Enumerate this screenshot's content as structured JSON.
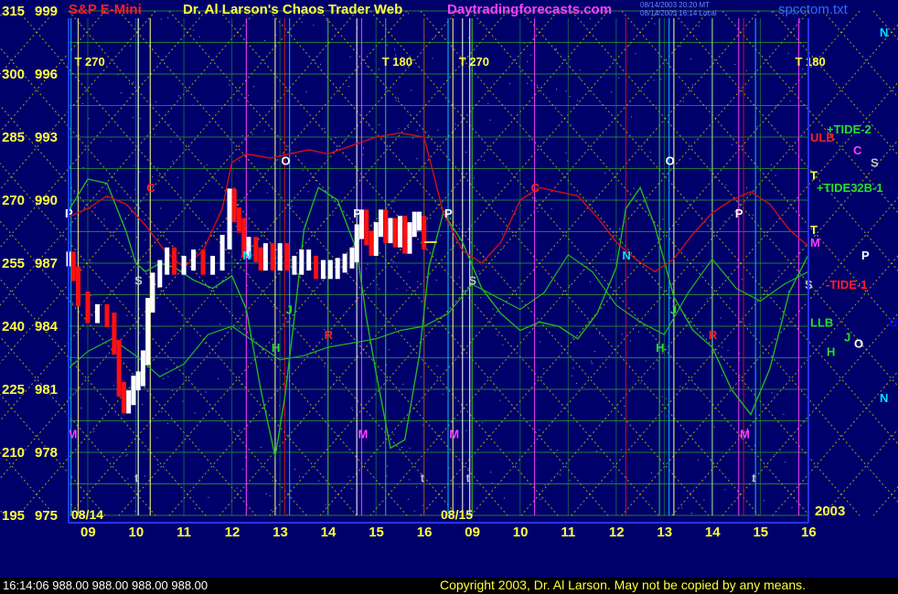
{
  "header": {
    "symbol": "S&P E-Mini",
    "title": "Dr. Al Larson's Chaos Trader Web",
    "site": "Daytradingforecasts.com",
    "stamp1": "08/14/2003 20:20 MT",
    "stamp2": "08/14/2003 16:14 Local",
    "file": "spcctom.txt"
  },
  "status": {
    "time": "16:14:06",
    "quotes": "988.00 988.00 988.00 988.00"
  },
  "copyright": "Copyright 2003, Dr. Al Larson. May not be copied by any means.",
  "colors": {
    "background": "#00006b",
    "grid": "#2ea12e",
    "diagonal": "#c8c800",
    "price_bar": "#ffffff",
    "down_bar": "#ff1010",
    "red_line": "#d01010",
    "green_line": "#23b623"
  },
  "chart_data": {
    "type": "line",
    "title": "S&P E-Mini",
    "days": [
      "08/14",
      "08/15"
    ],
    "year": "2003",
    "x_ticks": [
      "09",
      "10",
      "11",
      "12",
      "13",
      "14",
      "15",
      "16",
      "09",
      "10",
      "11",
      "12",
      "13",
      "14",
      "15",
      "16"
    ],
    "ylim": [
      975,
      999
    ],
    "y_axis": [
      {
        "price": 999,
        "label": "315"
      },
      {
        "price": 996,
        "label": "300"
      },
      {
        "price": 993,
        "label": "285"
      },
      {
        "price": 990,
        "label": "270"
      },
      {
        "price": 987,
        "label": "255"
      },
      {
        "price": 984,
        "label": "240"
      },
      {
        "price": 981,
        "label": "225"
      },
      {
        "price": 978,
        "label": "210"
      },
      {
        "price": 975,
        "label": "195"
      }
    ],
    "price_series": {
      "name": "S&P E-Mini",
      "t": [
        8.6,
        8.7,
        8.8,
        9.0,
        9.2,
        9.4,
        9.55,
        9.65,
        9.75,
        9.85,
        9.95,
        10.05,
        10.15,
        10.25,
        10.35,
        10.5,
        10.65,
        10.8,
        11.0,
        11.2,
        11.4,
        11.6,
        11.8,
        11.95,
        12.05,
        12.15,
        12.25,
        12.35,
        12.5,
        12.6,
        12.7,
        12.85,
        13.0,
        13.15,
        13.3,
        13.45,
        13.6,
        13.75,
        13.9,
        14.05,
        14.2,
        14.35,
        14.5,
        14.6,
        14.7,
        14.8,
        14.9,
        15.0,
        15.1,
        15.2,
        15.3,
        15.4,
        15.5,
        15.6,
        15.7,
        15.8,
        15.9,
        16.0
      ],
      "close": [
        987.2,
        986.5,
        985.3,
        984.5,
        984.7,
        984.3,
        983.0,
        981.0,
        980.2,
        980.6,
        981.3,
        981.5,
        982.5,
        985.0,
        986.2,
        986.8,
        987.4,
        986.8,
        987.0,
        987.3,
        986.8,
        987.0,
        988.0,
        990.2,
        989.3,
        988.8,
        987.6,
        987.9,
        987.4,
        987.0,
        987.6,
        987.0,
        987.6,
        987.0,
        986.8,
        987.3,
        987.0,
        986.6,
        986.8,
        986.6,
        986.9,
        987.1,
        987.4,
        988.5,
        989.2,
        988.2,
        987.7,
        988.6,
        989.2,
        988.3,
        988.8,
        988.1,
        988.9,
        987.8,
        988.6,
        989.1,
        988.9,
        988.0
      ]
    },
    "red_series": {
      "name": "R",
      "t": [
        8.6,
        9.0,
        9.4,
        9.8,
        10.2,
        10.6,
        11.0,
        11.4,
        11.8,
        12.0,
        12.3,
        12.8,
        13.2,
        13.6,
        14.0,
        14.5,
        15.0,
        15.5,
        16.0,
        16.4,
        16.8,
        17.2,
        17.6,
        18.0,
        18.4,
        18.8,
        19.2,
        19.6,
        20.0,
        20.4,
        20.8,
        21.2,
        21.6,
        22.0,
        22.4,
        22.8,
        23.2,
        23.6,
        24.0
      ],
      "values": [
        989.2,
        989.6,
        990.2,
        989.8,
        988.8,
        987.6,
        986.8,
        987.6,
        989.6,
        991.8,
        992.2,
        992.0,
        992.2,
        992.4,
        992.2,
        992.6,
        993.0,
        993.2,
        993.0,
        989.4,
        987.6,
        987.0,
        988.0,
        990.0,
        990.6,
        990.4,
        990.2,
        989.2,
        988.0,
        987.2,
        986.6,
        987.2,
        988.4,
        989.4,
        990.0,
        990.4,
        989.8,
        988.6,
        987.8
      ]
    },
    "green_series": {
      "name": "J",
      "t": [
        8.6,
        9.0,
        9.4,
        9.8,
        10.0,
        10.2,
        10.5,
        10.8,
        11.2,
        11.6,
        12.0,
        12.3,
        12.6,
        12.9,
        13.1,
        13.3,
        13.5,
        13.8,
        14.2,
        14.6,
        14.8,
        15.0,
        15.3,
        15.6,
        15.9,
        16.1,
        16.4,
        16.8,
        17.2,
        17.6,
        18.0,
        18.4,
        18.8,
        19.2,
        19.6,
        20.0,
        20.2,
        20.5,
        20.8,
        21.2,
        21.6,
        22.0,
        22.4,
        22.8,
        23.2,
        23.6,
        24.0
      ],
      "values": [
        989.5,
        991.0,
        990.8,
        988.5,
        987.0,
        986.6,
        987.0,
        986.8,
        986.2,
        985.8,
        986.4,
        984.8,
        981.0,
        977.8,
        980.6,
        984.4,
        988.6,
        990.6,
        990.0,
        987.6,
        984.4,
        981.8,
        978.2,
        978.6,
        982.6,
        986.8,
        989.4,
        988.0,
        985.8,
        984.6,
        983.8,
        984.2,
        984.0,
        983.4,
        984.6,
        986.8,
        989.6,
        990.6,
        988.8,
        985.4,
        983.8,
        983.0,
        981.0,
        979.8,
        982.0,
        985.6,
        987.4
      ]
    },
    "green_series_2": {
      "name": "H",
      "t": [
        8.6,
        9.0,
        9.5,
        10.0,
        10.5,
        11.0,
        11.5,
        12.0,
        12.5,
        13.0,
        13.5,
        14.0,
        14.5,
        15.0,
        15.5,
        16.0,
        16.5,
        17.0,
        17.5,
        18.0,
        18.5,
        19.0,
        19.5,
        20.0,
        20.5,
        21.0,
        21.5,
        22.0,
        22.5,
        23.0,
        23.5,
        24.0
      ],
      "values": [
        982.0,
        982.8,
        983.4,
        982.6,
        981.6,
        982.2,
        983.6,
        984.0,
        983.2,
        982.4,
        982.6,
        983.0,
        983.2,
        983.4,
        983.8,
        984.0,
        984.6,
        986.0,
        985.4,
        984.8,
        985.6,
        987.4,
        986.6,
        985.0,
        984.2,
        983.6,
        985.6,
        987.2,
        985.8,
        985.2,
        986.0,
        986.6
      ]
    },
    "vertical_markers": [
      {
        "label": "T 270",
        "t": 8.8,
        "level": 996.6
      },
      {
        "label": "T 180",
        "t": 15.2,
        "level": 996.6
      },
      {
        "label": "T 270",
        "t": 16.8,
        "level": 996.6
      },
      {
        "label": "T 180",
        "t": 23.8,
        "level": 996.6
      },
      {
        "label": "P",
        "t": 8.6,
        "level": 989.4
      },
      {
        "label": "M",
        "t": 8.65,
        "level": 978.9
      },
      {
        "label": "C",
        "t": 10.3,
        "level": 990.6
      },
      {
        "label": "S",
        "t": 10.05,
        "level": 986.2
      },
      {
        "label": "t",
        "t": 10.05,
        "level": 976.8
      },
      {
        "label": "N",
        "t": 12.3,
        "level": 987.4
      },
      {
        "label": "O",
        "t": 13.1,
        "level": 991.9
      },
      {
        "label": "J",
        "t": 13.2,
        "level": 984.8
      },
      {
        "label": "H",
        "t": 12.9,
        "level": 983.0
      },
      {
        "label": "R",
        "t": 14.0,
        "level": 983.6
      },
      {
        "label": "P",
        "t": 14.6,
        "level": 989.4
      },
      {
        "label": "M",
        "t": 14.7,
        "level": 978.9
      },
      {
        "label": "t",
        "t": 16.0,
        "level": 976.8
      },
      {
        "label": "P",
        "t": 16.5,
        "level": 989.4
      },
      {
        "label": "M",
        "t": 16.6,
        "level": 978.9
      },
      {
        "label": "S",
        "t": 17.0,
        "level": 986.2
      },
      {
        "label": "t",
        "t": 16.95,
        "level": 976.8
      },
      {
        "label": "C",
        "t": 18.3,
        "level": 990.6
      },
      {
        "label": "N",
        "t": 20.2,
        "level": 987.4
      },
      {
        "label": "O",
        "t": 21.1,
        "level": 991.9
      },
      {
        "label": "J",
        "t": 21.2,
        "level": 984.8
      },
      {
        "label": "H",
        "t": 20.9,
        "level": 983.0
      },
      {
        "label": "R",
        "t": 22.0,
        "level": 983.6
      },
      {
        "label": "P",
        "t": 22.55,
        "level": 989.4
      },
      {
        "label": "M",
        "t": 22.65,
        "level": 978.9
      },
      {
        "label": "t",
        "t": 22.9,
        "level": 976.8
      }
    ],
    "right_labels": [
      {
        "label": "+TIDE-2",
        "price": 993.4,
        "color": "#23e023"
      },
      {
        "label": "ULB",
        "price": 993.0,
        "color": "#ff2020"
      },
      {
        "label": "C",
        "price": 992.4,
        "color": "#ff40ff"
      },
      {
        "label": "S",
        "price": 991.8,
        "color": "#c0c0c0"
      },
      {
        "label": "T",
        "price": 991.2,
        "color": "#ffff40"
      },
      {
        "label": "+TIDE32B-1",
        "price": 990.6,
        "color": "#23e023"
      },
      {
        "label": "T",
        "price": 988.6,
        "color": "#ffff40"
      },
      {
        "label": "M",
        "price": 988.0,
        "color": "#ff40ff"
      },
      {
        "label": "P",
        "price": 987.4,
        "color": "#ffffff"
      },
      {
        "label": "S",
        "price": 986.0,
        "color": "#c0c0c0"
      },
      {
        "label": "-TIDE-1",
        "price": 986.0,
        "color": "#ff2020"
      },
      {
        "label": "LLB",
        "price": 984.2,
        "color": "#23e023"
      },
      {
        "label": "U",
        "price": 984.2,
        "color": "#0000ff"
      },
      {
        "label": "J",
        "price": 983.5,
        "color": "#23e023"
      },
      {
        "label": "O",
        "price": 983.2,
        "color": "#ffffff"
      },
      {
        "label": "H",
        "price": 982.8,
        "color": "#23e023"
      },
      {
        "label": "N",
        "price": 980.6,
        "color": "#00e0ff"
      },
      {
        "label": "N",
        "price": 998.0,
        "color": "#00e0ff"
      }
    ]
  }
}
